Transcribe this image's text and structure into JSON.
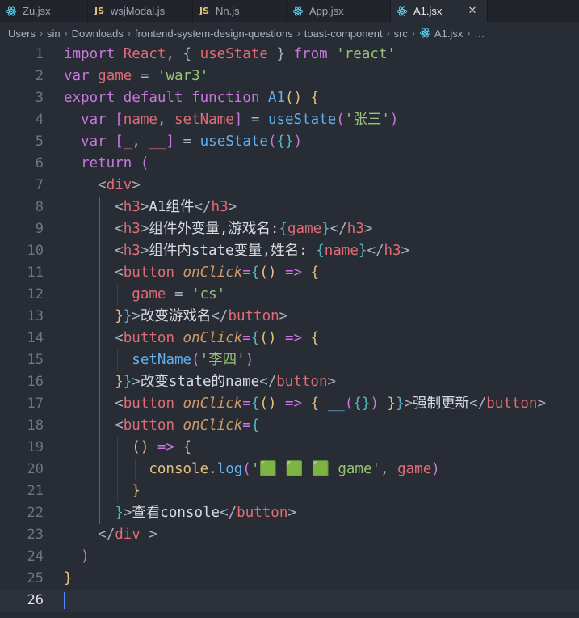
{
  "tabs": [
    {
      "label": "Zu.jsx",
      "icon": "react-icon",
      "width": 109,
      "active": false
    },
    {
      "label": "wsjModal.js",
      "icon": "js-icon",
      "width": 130,
      "active": false
    },
    {
      "label": "Nn.js",
      "icon": "js-icon",
      "width": 116,
      "active": false
    },
    {
      "label": "App.jsx",
      "icon": "react-icon",
      "width": 129,
      "active": false
    },
    {
      "label": "A1.jsx",
      "icon": "react-icon",
      "width": 120,
      "active": true
    }
  ],
  "breadcrumb": [
    "Users",
    "sin",
    "Downloads",
    "frontend-system-design-questions",
    "toast-component",
    "src",
    "A1.jsx",
    "…"
  ],
  "current_line": 26,
  "lines": [
    {
      "n": "1",
      "t": [
        [
          "kw",
          "import"
        ],
        [
          "pl",
          " "
        ],
        [
          "id",
          "React"
        ],
        [
          "pun",
          ", { "
        ],
        [
          "id",
          "useState"
        ],
        [
          "pun",
          " } "
        ],
        [
          "kw",
          "from"
        ],
        [
          "pl",
          " "
        ],
        [
          "str",
          "'react'"
        ]
      ]
    },
    {
      "n": "2",
      "t": [
        [
          "kw",
          "var"
        ],
        [
          "pl",
          " "
        ],
        [
          "id",
          "game"
        ],
        [
          "pl",
          " = "
        ],
        [
          "str",
          "'war3'"
        ]
      ]
    },
    {
      "n": "3",
      "t": [
        [
          "kw",
          "export"
        ],
        [
          "pl",
          " "
        ],
        [
          "kw",
          "default"
        ],
        [
          "pl",
          " "
        ],
        [
          "kw",
          "function"
        ],
        [
          "pl",
          " "
        ],
        [
          "fn",
          "A1"
        ],
        [
          "b1",
          "()"
        ],
        [
          "pl",
          " "
        ],
        [
          "b1",
          "{"
        ]
      ]
    },
    {
      "n": "4",
      "t": [
        [
          "pl",
          "  "
        ],
        [
          "kw",
          "var"
        ],
        [
          "pl",
          " "
        ],
        [
          "b2",
          "["
        ],
        [
          "id",
          "name"
        ],
        [
          "pun",
          ", "
        ],
        [
          "id",
          "setName"
        ],
        [
          "b2",
          "]"
        ],
        [
          "pl",
          " = "
        ],
        [
          "fn",
          "useState"
        ],
        [
          "b2",
          "("
        ],
        [
          "str",
          "'张三'"
        ],
        [
          "b2",
          ")"
        ]
      ]
    },
    {
      "n": "5",
      "t": [
        [
          "pl",
          "  "
        ],
        [
          "kw",
          "var"
        ],
        [
          "pl",
          " "
        ],
        [
          "b2",
          "["
        ],
        [
          "id",
          "_"
        ],
        [
          "pun",
          ", "
        ],
        [
          "id",
          "__"
        ],
        [
          "b2",
          "]"
        ],
        [
          "pl",
          " = "
        ],
        [
          "fn",
          "useState"
        ],
        [
          "b2",
          "("
        ],
        [
          "b3",
          "{}"
        ],
        [
          "b2",
          ")"
        ]
      ]
    },
    {
      "n": "6",
      "t": [
        [
          "pl",
          "  "
        ],
        [
          "kw",
          "return"
        ],
        [
          "pl",
          " "
        ],
        [
          "b2",
          "("
        ]
      ]
    },
    {
      "n": "7",
      "t": [
        [
          "pl",
          "    "
        ],
        [
          "pun",
          "<"
        ],
        [
          "tag",
          "div"
        ],
        [
          "pun",
          ">"
        ]
      ]
    },
    {
      "n": "8",
      "t": [
        [
          "pl",
          "      "
        ],
        [
          "pun",
          "<"
        ],
        [
          "tag",
          "h3"
        ],
        [
          "pun",
          ">"
        ],
        [
          "txt",
          "A1组件"
        ],
        [
          "pun",
          "</"
        ],
        [
          "tag",
          "h3"
        ],
        [
          "pun",
          ">"
        ]
      ]
    },
    {
      "n": "9",
      "t": [
        [
          "pl",
          "      "
        ],
        [
          "pun",
          "<"
        ],
        [
          "tag",
          "h3"
        ],
        [
          "pun",
          ">"
        ],
        [
          "txt",
          "组件外变量,游戏名:"
        ],
        [
          "b3",
          "{"
        ],
        [
          "id",
          "game"
        ],
        [
          "b3",
          "}"
        ],
        [
          "pun",
          "</"
        ],
        [
          "tag",
          "h3"
        ],
        [
          "pun",
          ">"
        ]
      ]
    },
    {
      "n": "10",
      "t": [
        [
          "pl",
          "      "
        ],
        [
          "pun",
          "<"
        ],
        [
          "tag",
          "h3"
        ],
        [
          "pun",
          ">"
        ],
        [
          "txt",
          "组件内state变量,姓名: "
        ],
        [
          "b3",
          "{"
        ],
        [
          "id",
          "name"
        ],
        [
          "b3",
          "}"
        ],
        [
          "pun",
          "</"
        ],
        [
          "tag",
          "h3"
        ],
        [
          "pun",
          ">"
        ]
      ]
    },
    {
      "n": "11",
      "t": [
        [
          "pl",
          "      "
        ],
        [
          "pun",
          "<"
        ],
        [
          "tag",
          "button"
        ],
        [
          "pl",
          " "
        ],
        [
          "attr",
          "onClick"
        ],
        [
          "op",
          "="
        ],
        [
          "b3",
          "{"
        ],
        [
          "b1",
          "()"
        ],
        [
          "pl",
          " "
        ],
        [
          "op",
          "=>"
        ],
        [
          "pl",
          " "
        ],
        [
          "b1",
          "{"
        ]
      ]
    },
    {
      "n": "12",
      "t": [
        [
          "pl",
          "        "
        ],
        [
          "id",
          "game"
        ],
        [
          "pl",
          " = "
        ],
        [
          "str",
          "'cs'"
        ]
      ]
    },
    {
      "n": "13",
      "t": [
        [
          "pl",
          "      "
        ],
        [
          "b1",
          "}"
        ],
        [
          "b3",
          "}"
        ],
        [
          "pun",
          ">"
        ],
        [
          "txt",
          "改变游戏名"
        ],
        [
          "pun",
          "</"
        ],
        [
          "tag",
          "button"
        ],
        [
          "pun",
          ">"
        ]
      ]
    },
    {
      "n": "14",
      "t": [
        [
          "pl",
          "      "
        ],
        [
          "pun",
          "<"
        ],
        [
          "tag",
          "button"
        ],
        [
          "pl",
          " "
        ],
        [
          "attr",
          "onClick"
        ],
        [
          "op",
          "="
        ],
        [
          "b3",
          "{"
        ],
        [
          "b1",
          "()"
        ],
        [
          "pl",
          " "
        ],
        [
          "op",
          "=>"
        ],
        [
          "pl",
          " "
        ],
        [
          "b1",
          "{"
        ]
      ]
    },
    {
      "n": "15",
      "t": [
        [
          "pl",
          "        "
        ],
        [
          "fn",
          "setName"
        ],
        [
          "b2",
          "("
        ],
        [
          "str",
          "'李四'"
        ],
        [
          "b2",
          ")"
        ]
      ]
    },
    {
      "n": "16",
      "t": [
        [
          "pl",
          "      "
        ],
        [
          "b1",
          "}"
        ],
        [
          "b3",
          "}"
        ],
        [
          "pun",
          ">"
        ],
        [
          "txt",
          "改变state的name"
        ],
        [
          "pun",
          "</"
        ],
        [
          "tag",
          "button"
        ],
        [
          "pun",
          ">"
        ]
      ]
    },
    {
      "n": "17",
      "t": [
        [
          "pl",
          "      "
        ],
        [
          "pun",
          "<"
        ],
        [
          "tag",
          "button"
        ],
        [
          "pl",
          " "
        ],
        [
          "attr",
          "onClick"
        ],
        [
          "op",
          "="
        ],
        [
          "b3",
          "{"
        ],
        [
          "b1",
          "()"
        ],
        [
          "pl",
          " "
        ],
        [
          "op",
          "=>"
        ],
        [
          "pl",
          " "
        ],
        [
          "b1",
          "{"
        ],
        [
          "pl",
          " "
        ],
        [
          "fn",
          "__"
        ],
        [
          "b2",
          "("
        ],
        [
          "b3",
          "{}"
        ],
        [
          "b2",
          ")"
        ],
        [
          "pl",
          " "
        ],
        [
          "b1",
          "}"
        ],
        [
          "b3",
          "}"
        ],
        [
          "pun",
          ">"
        ],
        [
          "txt",
          "强制更新"
        ],
        [
          "pun",
          "</"
        ],
        [
          "tag",
          "button"
        ],
        [
          "pun",
          ">"
        ]
      ]
    },
    {
      "n": "18",
      "t": [
        [
          "pl",
          "      "
        ],
        [
          "pun",
          "<"
        ],
        [
          "tag",
          "button"
        ],
        [
          "pl",
          " "
        ],
        [
          "attr",
          "onClick"
        ],
        [
          "op",
          "="
        ],
        [
          "b3",
          "{"
        ]
      ]
    },
    {
      "n": "19",
      "t": [
        [
          "pl",
          "        "
        ],
        [
          "b1",
          "()"
        ],
        [
          "pl",
          " "
        ],
        [
          "op",
          "=>"
        ],
        [
          "pl",
          " "
        ],
        [
          "b1",
          "{"
        ]
      ]
    },
    {
      "n": "20",
      "t": [
        [
          "pl",
          "          "
        ],
        [
          "cls",
          "console"
        ],
        [
          "pun",
          "."
        ],
        [
          "fn",
          "log"
        ],
        [
          "b2",
          "("
        ],
        [
          "str",
          "'🟩 🟩 🟩 game'"
        ],
        [
          "pun",
          ", "
        ],
        [
          "id",
          "game"
        ],
        [
          "b2",
          ")"
        ]
      ]
    },
    {
      "n": "21",
      "t": [
        [
          "pl",
          "        "
        ],
        [
          "b1",
          "}"
        ]
      ]
    },
    {
      "n": "22",
      "t": [
        [
          "pl",
          "      "
        ],
        [
          "b3",
          "}"
        ],
        [
          "pun",
          ">"
        ],
        [
          "txt",
          "查看console"
        ],
        [
          "pun",
          "</"
        ],
        [
          "tag",
          "button"
        ],
        [
          "pun",
          ">"
        ]
      ]
    },
    {
      "n": "23",
      "t": [
        [
          "pl",
          "    "
        ],
        [
          "pun",
          "</"
        ],
        [
          "tag",
          "div"
        ],
        [
          "pl",
          " "
        ],
        [
          "pun",
          ">"
        ]
      ]
    },
    {
      "n": "24",
      "t": [
        [
          "pl",
          "  "
        ],
        [
          "b2",
          ")"
        ]
      ]
    },
    {
      "n": "25",
      "t": [
        [
          "b1",
          "}"
        ]
      ]
    },
    {
      "n": "26",
      "t": []
    }
  ]
}
